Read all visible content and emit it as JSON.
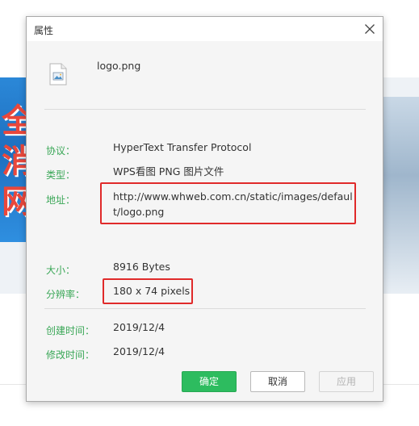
{
  "dialog": {
    "title": "属性",
    "file_name": "logo.png",
    "buttons": {
      "ok": "确定",
      "cancel": "取消",
      "apply": "应用"
    }
  },
  "properties": {
    "protocol": {
      "label": "协议：",
      "value": "HyperText Transfer Protocol"
    },
    "type": {
      "label": "类型：",
      "value": "WPS看图 PNG 图片文件"
    },
    "address": {
      "label": "地址：",
      "value": "http://www.whweb.com.cn/static/images/default/logo.png"
    },
    "size": {
      "label": "大小：",
      "value": "8916 Bytes"
    },
    "resolution": {
      "label": "分辨率：",
      "value": "180 x 74 pixels"
    },
    "created": {
      "label": "创建时间：",
      "value": "2019/12/4"
    },
    "modified": {
      "label": "修改时间：",
      "value": "2019/12/4"
    }
  },
  "colors": {
    "label_green": "#3aa757",
    "ok_button": "#2dbc5f",
    "highlight_red": "#e02a2a"
  },
  "icons": {
    "close": "close-icon",
    "file": "image-file-icon"
  }
}
